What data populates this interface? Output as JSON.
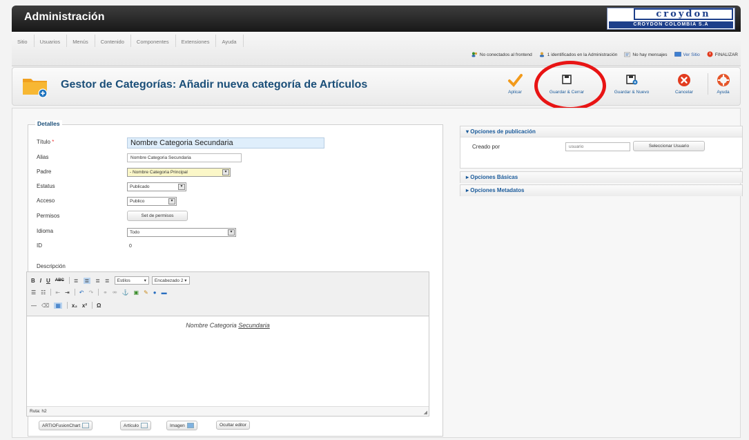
{
  "header": {
    "title": "Administración",
    "logo": {
      "word": "croydon",
      "sub": "CROYDON COLOMBIA S.A"
    }
  },
  "menus": [
    "Sitio",
    "Usuarios",
    "Menús",
    "Contenido",
    "Componentes",
    "Extensiones",
    "Ayuda"
  ],
  "status": {
    "frontend": "No conectados al frontend",
    "admin": "1 identificados en la Administración",
    "messages": "No hay mensajes",
    "view_site": "Ver Sitio",
    "logout": "FINALIZAR"
  },
  "toolbar": {
    "page_title": "Gestor de Categorías: Añadir nueva categoría de Artículos",
    "apply": "Aplicar",
    "save_close": "Guardar & Cerrar",
    "save_new": "Guardar & Nuevo",
    "cancel": "Cancelar",
    "help": "Ayuda"
  },
  "details": {
    "legend": "Detalles",
    "title_label": "Título",
    "title_required": "*",
    "title_value": "Nombre Categoria Secundaria",
    "alias_label": "Alias",
    "alias_value": "Nombre Categoria Secundaria",
    "parent_label": "Padre",
    "parent_value": "- Nombre Categoria Principal",
    "status_label": "Estatus",
    "status_value": "Publicado",
    "access_label": "Acceso",
    "access_value": "Publico",
    "permissions_label": "Permisos",
    "permissions_button": "Set de permisos",
    "language_label": "Idioma",
    "language_value": "Todo",
    "id_label": "ID",
    "id_value": "0",
    "description_label": "Descripción"
  },
  "editor": {
    "styles_select": "Estilos",
    "heading_select": "Encabezado 2",
    "content_text": "Nombre Categoria",
    "content_underlined": "Secundaria",
    "path": "Ruta: h2",
    "buttons": {
      "artio": "ARTIOFusionChart",
      "article": "Artículo",
      "image": "Imagen",
      "hide_editor": "Ocultar editor"
    }
  },
  "publishing": {
    "header": "▾ Opciones de publicación",
    "created_by_label": "Creado por",
    "created_by_value": "usuario",
    "select_user_button": "Seleccionar Usuario"
  },
  "basic_options": "▸ Opciones Básicas",
  "metadata_options": "▸ Opciones Metadatos",
  "colors": {
    "header_bg": "#222222",
    "title_blue": "#1a4e78",
    "highlight_circle": "#e81414"
  }
}
